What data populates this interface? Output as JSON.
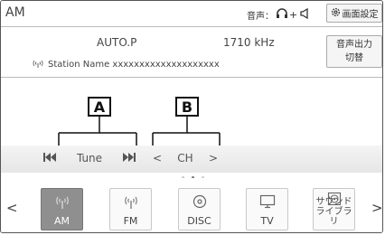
{
  "header": {
    "title": "AM",
    "audio_status_label": "音声：",
    "screen_settings_label": "画面設定"
  },
  "station": {
    "mode": "AUTO.P",
    "frequency": "1710 kHz",
    "name": "Station Name xxxxxxxxxxxxxxxxxxxx"
  },
  "audio_output_button": {
    "line1": "音声出力",
    "line2": "切替"
  },
  "callouts": {
    "a": "A",
    "b": "B"
  },
  "controls": {
    "tune": {
      "prev_icon": "seek-back-icon",
      "label": "Tune",
      "next_icon": "seek-forward-icon"
    },
    "channel": {
      "prev": "<",
      "label": "CH",
      "next": ">"
    }
  },
  "pagination": {
    "pages": 3,
    "current": 2
  },
  "sources": {
    "left_arrow": "<",
    "right_arrow": ">",
    "items": [
      {
        "label": "AM",
        "icon": "radio-antenna-icon",
        "active": true
      },
      {
        "label": "FM",
        "icon": "radio-antenna-icon",
        "active": false
      },
      {
        "label": "DISC",
        "icon": "disc-icon",
        "active": false
      },
      {
        "label": "TV",
        "icon": "tv-icon",
        "active": false
      },
      {
        "label": "サウンド",
        "label2": "ライブラリ",
        "icon": "sound-library-icon",
        "active": false
      }
    ]
  },
  "colors": {
    "active_tile": "#8f8f8f",
    "border": "#555555"
  }
}
